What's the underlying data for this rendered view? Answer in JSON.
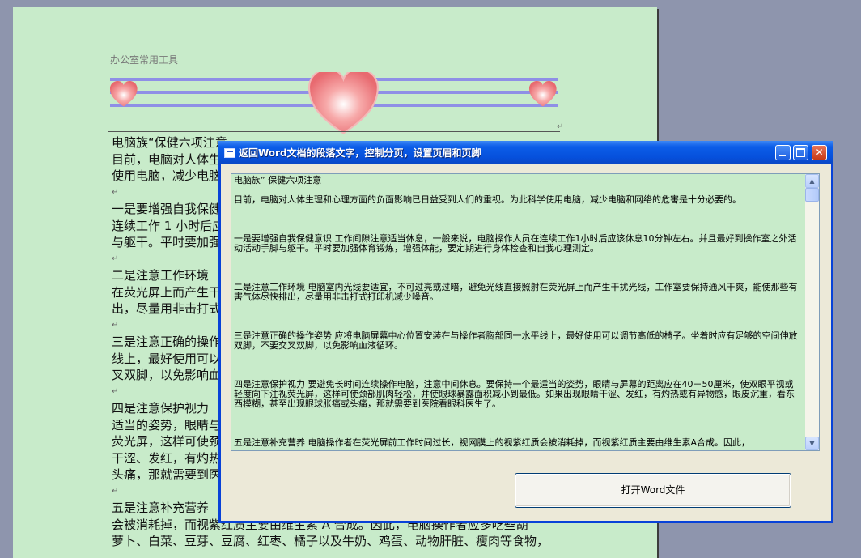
{
  "document": {
    "header": "办公室常用工具",
    "paragraph_mark": "↵",
    "lines": [
      "电脑族“保健六项注意",
      "目前，电脑对人体生",
      "使用电脑，减少电脑",
      "一是要增强自我保健",
      "连续工作 1 小时后应",
      "与躯干。平时要加强",
      "二是注意工作环境",
      "在荧光屏上而产生干",
      "出，尽量用非击打式",
      "三是注意正确的操作",
      "线上，最好使用可以",
      "叉双脚，以免影响血",
      "四是注意保护视力",
      "适当的姿势，眼睛与",
      "荧光屏，这样可使颈",
      "干涩、发红，有灼热",
      "头痛，那就需要到医",
      "五是注意补充营养",
      "会被消耗掉，而视紫红质主要由维生素 A 合成。因此，电脑操作者应多吃些胡",
      "萝卜、白菜、豆芽、豆腐、红枣、橘子以及牛奶、鸡蛋、动物肝脏、瘦肉等食物，"
    ]
  },
  "dialog": {
    "title": "返回Word文档的段落文字，控制分页，设置页眉和页脚",
    "paragraphs": [
      "电脑族” 保健六项注意",
      "目前，电脑对人体生理和心理方面的负面影响已日益受到人们的重视。为此科学使用电脑，减少电脑和网络的危害是十分必要的。",
      "一是要增强自我保健意识 工作间隙注意适当休息，一般来说，电脑操作人员在连续工作1小时后应该休息10分钟左右。并且最好到操作室之外活动活动手脚与躯干。平时要加强体育锻炼，增强体能，要定期进行身体检查和自我心理测定。",
      "二是注意工作环境 电脑室内光线要适宜，不可过亮或过暗，避免光线直接照射在荧光屏上而产生干扰光线，工作室要保持通风干爽，能使那些有害气体尽快排出，尽量用非击打式打印机减少噪音。",
      "三是注意正确的操作姿势 应将电脑屏幕中心位置安装在与操作者胸部同一水平线上，最好使用可以调节高低的椅子。坐着时应有足够的空间伸放双脚，不要交叉双脚，以免影响血液循环。",
      "四是注意保护视力 要避免长时间连续操作电脑，注意中间休息。要保持一个最适当的姿势，眼睛与屏幕的距离应在40－50厘米，使双眼平视或轻度向下注视荧光屏，这样可使颈部肌肉轻松，并使眼球暴露面积减小到最低。如果出现眼睛干涩、发红，有灼热或有异物感，眼皮沉重，看东西模糊，甚至出现眼球胀痛或头痛，那就需要到医院看眼科医生了。",
      "五是注意补充营养 电脑操作者在荧光屏前工作时间过长，视网膜上的视紫红质会被消耗掉，而视紫红质主要由维生素A合成。因此，"
    ],
    "open_button_label": "打开Word文件"
  },
  "colors": {
    "desktop": "#8e95ad",
    "page": "#c8ebca",
    "titlebar": "#0650dc",
    "dialog_face": "#ece9d8"
  },
  "icons": [
    "window-icon",
    "minimize-icon",
    "maximize-icon",
    "close-icon",
    "scroll-up-icon",
    "scroll-down-icon",
    "heart-icon"
  ]
}
